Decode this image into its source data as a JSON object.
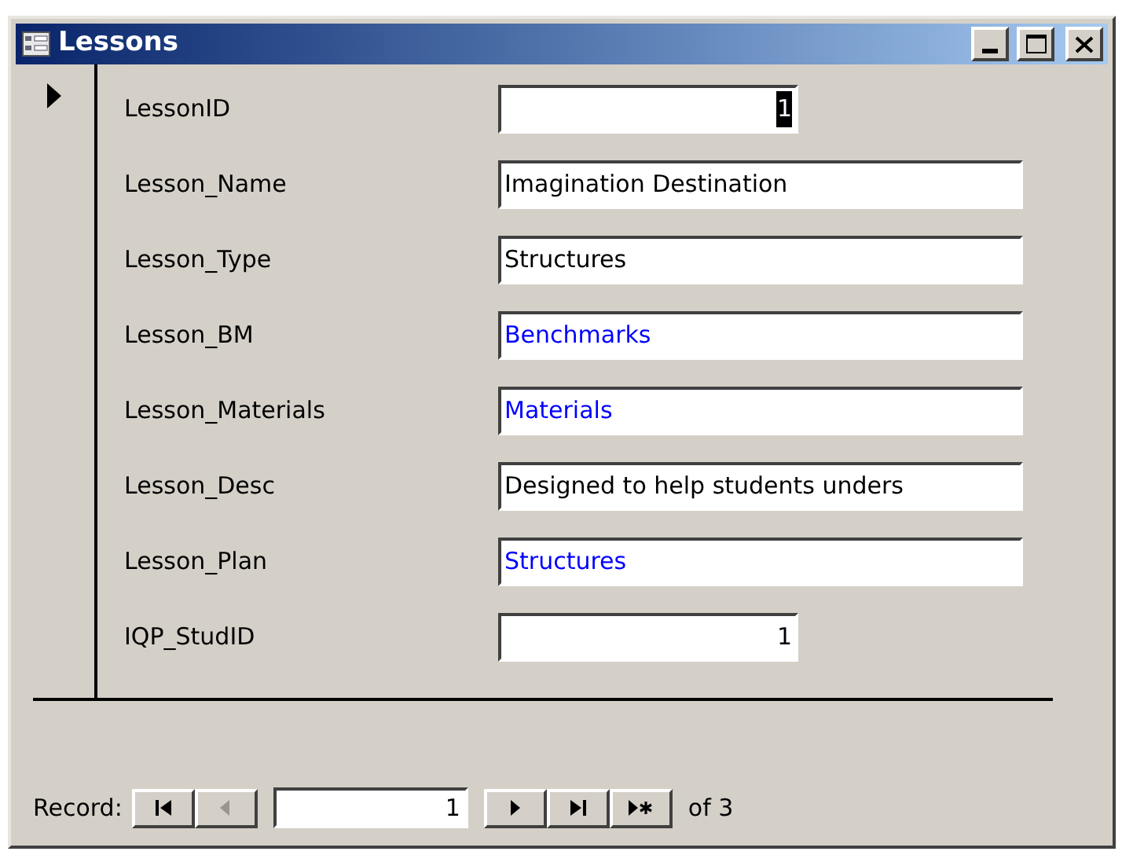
{
  "window": {
    "title": "Lessons"
  },
  "record_selector": {
    "current": true
  },
  "fields": [
    {
      "label": "LessonID",
      "value": "1",
      "kind": "number",
      "link": false,
      "highlighted": true
    },
    {
      "label": "Lesson_Name",
      "value": "Imagination Destination",
      "kind": "text",
      "link": false,
      "highlighted": false
    },
    {
      "label": "Lesson_Type",
      "value": "Structures",
      "kind": "text",
      "link": false,
      "highlighted": false
    },
    {
      "label": "Lesson_BM",
      "value": "Benchmarks",
      "kind": "text",
      "link": true,
      "highlighted": false
    },
    {
      "label": "Lesson_Materials",
      "value": "Materials",
      "kind": "text",
      "link": true,
      "highlighted": false
    },
    {
      "label": "Lesson_Desc",
      "value": "Designed to help students unders",
      "kind": "text",
      "link": false,
      "highlighted": false
    },
    {
      "label": "Lesson_Plan",
      "value": "Structures",
      "kind": "text",
      "link": true,
      "highlighted": false
    },
    {
      "label": "IQP_StudID",
      "value": "1",
      "kind": "number",
      "link": false,
      "highlighted": false
    }
  ],
  "navigation": {
    "label": "Record:",
    "current": "1",
    "total": "of 3",
    "buttons": [
      {
        "kind": "first",
        "disabled": false
      },
      {
        "kind": "prev",
        "disabled": true
      },
      {
        "kind": "next",
        "disabled": false
      },
      {
        "kind": "last",
        "disabled": false
      },
      {
        "kind": "new",
        "disabled": false
      }
    ]
  }
}
